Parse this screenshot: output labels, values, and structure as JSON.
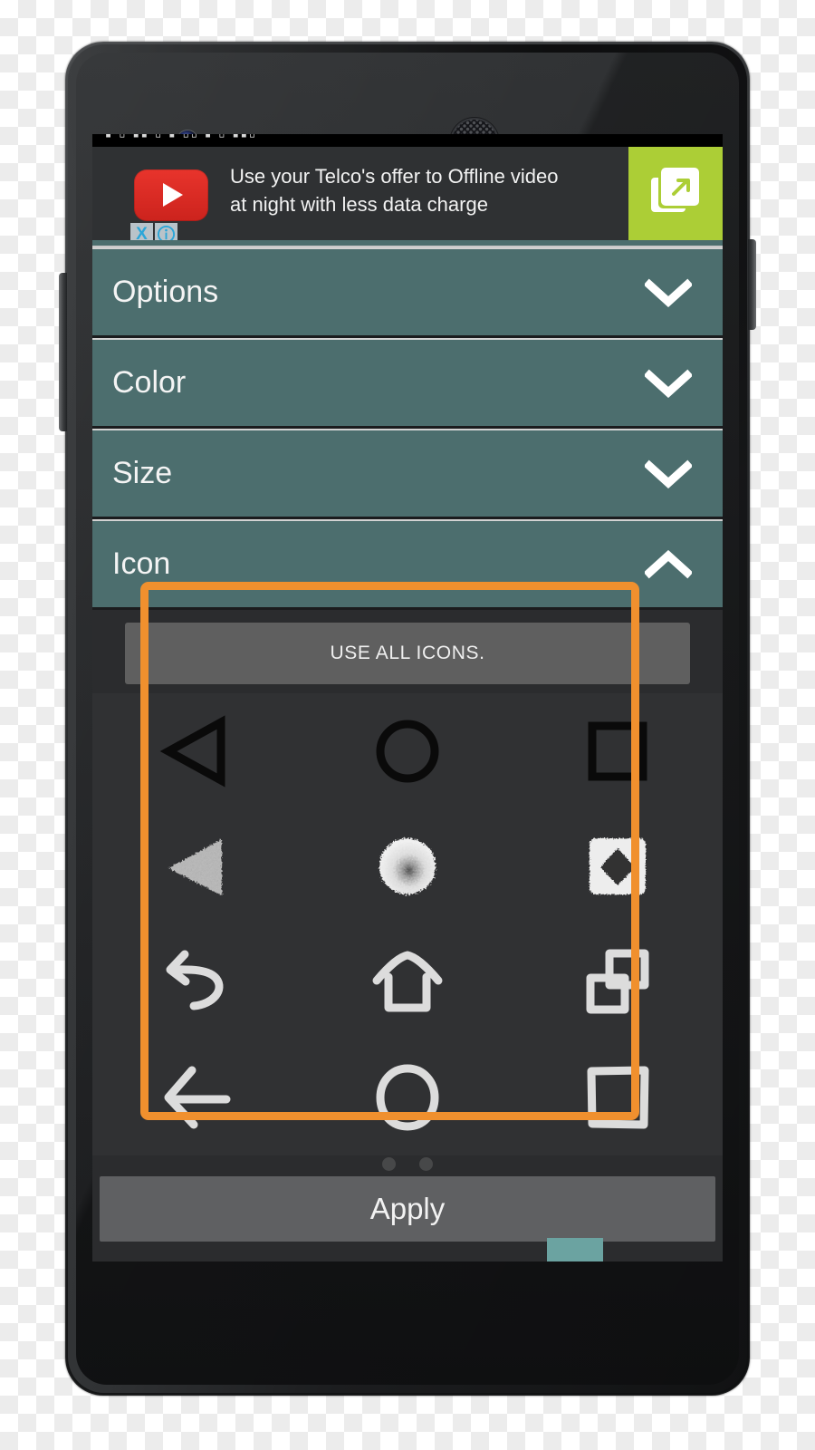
{
  "device": {
    "name": "android-phone-mockup",
    "model_style": "nexus-5",
    "hardware": {
      "front_camera": "front-camera",
      "earpiece": "earpiece-speaker",
      "proximity_sensor": "proximity-sensor",
      "light_sensor": "light-sensor",
      "volume_rocker": "volume-rocker",
      "power_button": "power-button"
    }
  },
  "statusbar": {
    "glyphs": "▮ ▯ ▮▮ ▯ ▮ ▯▯ ▮ ▯ ▮▮▯"
  },
  "ad": {
    "network_icon": "youtube-play-icon",
    "headline_line1": "Use your Telco's offer to Offline video",
    "headline_line2": "at night with less data charge",
    "cta_icon": "external-link-icon",
    "cta_bg_color": "#acce36",
    "close_label": "X",
    "info_label": "i"
  },
  "accordion": {
    "rows": [
      {
        "label": "Options",
        "icon": "chevron-down-icon",
        "expanded": false
      },
      {
        "label": "Color",
        "icon": "chevron-down-icon",
        "expanded": false
      },
      {
        "label": "Size",
        "icon": "chevron-down-icon",
        "expanded": false
      },
      {
        "label": "Icon",
        "icon": "chevron-up-icon",
        "expanded": true
      }
    ],
    "row_color": "#4c6e6e"
  },
  "picker": {
    "use_all_label": "USE ALL ICONS.",
    "highlight_color": "#f0902e",
    "icons": [
      {
        "name": "back-triangle-solid-outline-icon",
        "style": "stock-outline"
      },
      {
        "name": "home-circle-outline-icon",
        "style": "stock-outline"
      },
      {
        "name": "recents-square-outline-icon",
        "style": "stock-outline"
      },
      {
        "name": "back-triangle-textured-icon",
        "style": "textured-white"
      },
      {
        "name": "home-circle-textured-icon",
        "style": "textured-white"
      },
      {
        "name": "recents-square-diamond-icon",
        "style": "textured-white"
      },
      {
        "name": "back-undo-arrow-sketch-icon",
        "style": "sketch-white"
      },
      {
        "name": "home-house-sketch-icon",
        "style": "sketch-white"
      },
      {
        "name": "recents-overlap-squares-sketch-icon",
        "style": "sketch-white"
      },
      {
        "name": "back-left-arrow-sketch-icon",
        "style": "sketch-white"
      },
      {
        "name": "home-circle-sketch-icon",
        "style": "sketch-white"
      },
      {
        "name": "recents-square-sketch-icon",
        "style": "sketch-white"
      }
    ],
    "pager_dots": 2,
    "pager_active_index": 0
  },
  "footer": {
    "apply_label": "Apply",
    "nav_hint_color": "#6ba3a1"
  }
}
